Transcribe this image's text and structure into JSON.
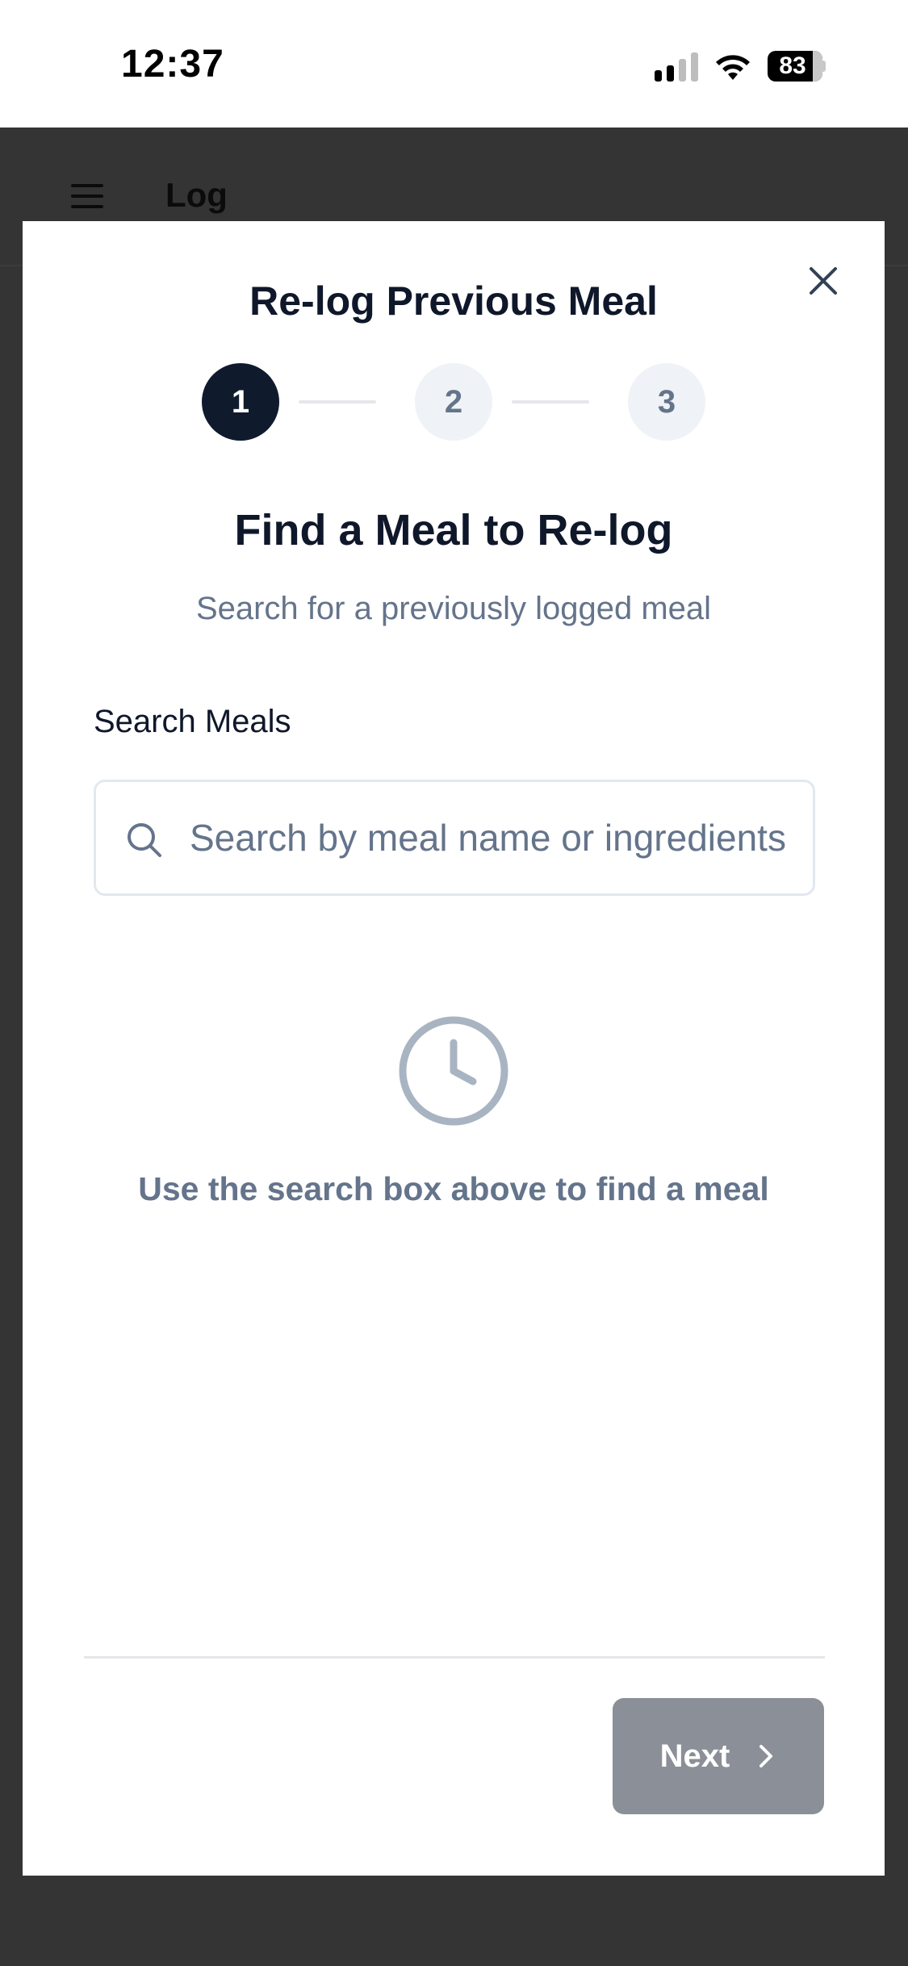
{
  "status_bar": {
    "time": "12:37",
    "battery": "83"
  },
  "header": {
    "title": "Log"
  },
  "modal": {
    "title": "Re-log Previous Meal",
    "steps": [
      {
        "label": "1",
        "state": "active"
      },
      {
        "label": "2",
        "state": "inactive"
      },
      {
        "label": "3",
        "state": "inactive"
      }
    ],
    "heading": "Find a Meal to Re-log",
    "subtitle": "Search for a previously logged meal",
    "search": {
      "label": "Search Meals",
      "placeholder": "Search by meal name or ingredients",
      "value": ""
    },
    "empty_state": {
      "icon": "clock-icon",
      "text": "Use the search box above to find a meal"
    },
    "next_label": "Next"
  },
  "colors": {
    "overlay": "#343434",
    "primary_dark": "#0f1b2d",
    "muted_text": "#64748b",
    "disabled_button": "#8b8f98"
  }
}
